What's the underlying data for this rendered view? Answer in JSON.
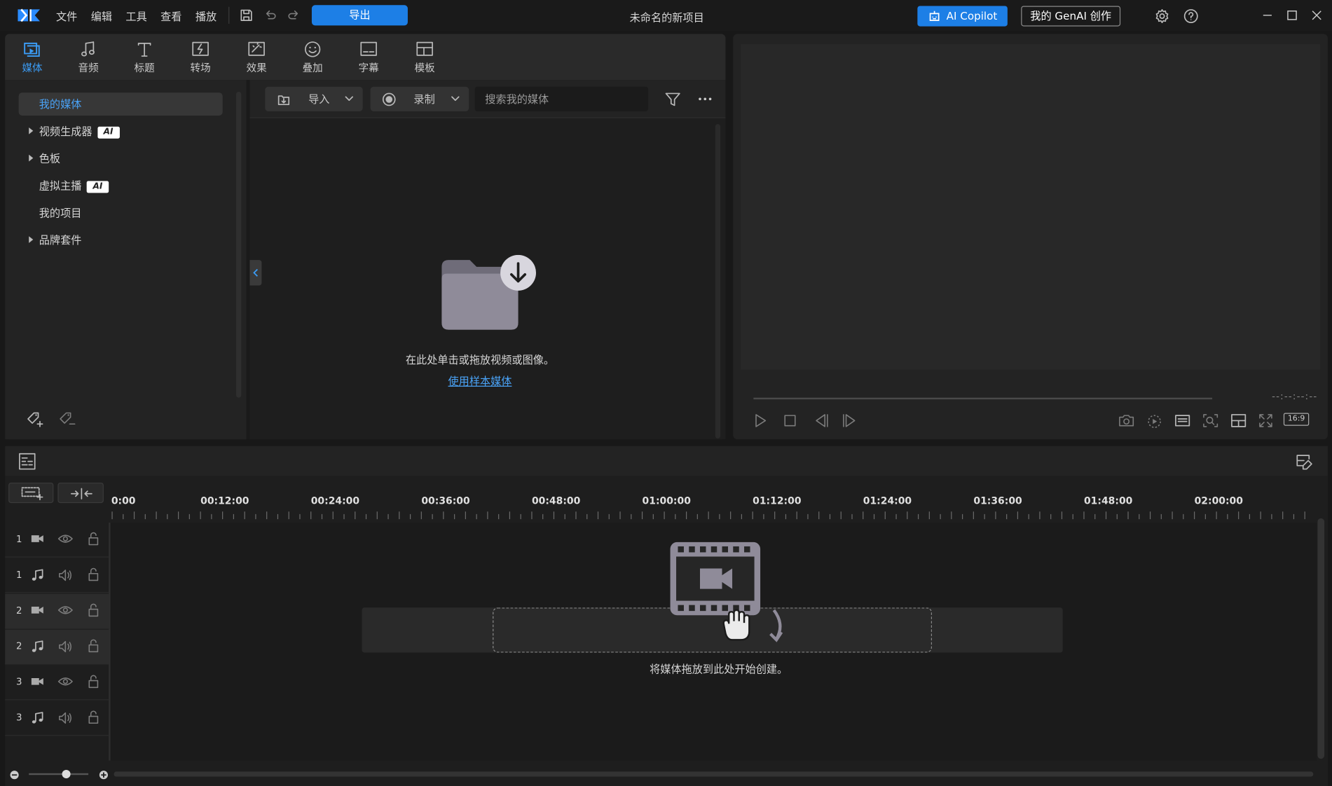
{
  "title_bar": {
    "menus": [
      "文件",
      "编辑",
      "工具",
      "查看",
      "播放"
    ],
    "export_label": "导出",
    "project_title": "未命名的新项目",
    "copilot_label": "AI Copilot",
    "genai_label": "我的 GenAI 创作"
  },
  "tabs": [
    {
      "label": "媒体",
      "icon": "media-icon",
      "active": true
    },
    {
      "label": "音频",
      "icon": "music-note-icon"
    },
    {
      "label": "标题",
      "icon": "title-t-icon"
    },
    {
      "label": "转场",
      "icon": "transition-icon"
    },
    {
      "label": "效果",
      "icon": "effects-icon"
    },
    {
      "label": "叠加",
      "icon": "sticker-icon"
    },
    {
      "label": "字幕",
      "icon": "subtitle-icon"
    },
    {
      "label": "模板",
      "icon": "template-icon"
    }
  ],
  "tree": [
    {
      "label": "我的媒体",
      "active": true
    },
    {
      "label": "视频生成器",
      "expandable": true,
      "badge": "AI"
    },
    {
      "label": "色板",
      "expandable": true
    },
    {
      "label": "虚拟主播",
      "badge": "AI"
    },
    {
      "label": "我的项目"
    },
    {
      "label": "品牌套件",
      "expandable": true
    }
  ],
  "toolbar": {
    "import_label": "导入",
    "record_label": "录制",
    "search_placeholder": "搜索我的媒体"
  },
  "media_area": {
    "empty_message": "在此处单击或拖放视频或图像。",
    "sample_link": "使用样本媒体"
  },
  "preview": {
    "timecode": "--:--:--:--",
    "aspect_ratio": "16:9"
  },
  "timeline": {
    "ruler_labels": [
      "0:00",
      "00:12:00",
      "00:24:00",
      "00:36:00",
      "00:48:00",
      "01:00:00",
      "01:12:00",
      "01:24:00",
      "01:36:00",
      "01:48:00",
      "02:00:00"
    ],
    "tracks": [
      {
        "num": "1",
        "type": "video"
      },
      {
        "num": "1",
        "type": "audio"
      },
      {
        "num": "2",
        "type": "video"
      },
      {
        "num": "2",
        "type": "audio"
      },
      {
        "num": "3",
        "type": "video"
      },
      {
        "num": "3",
        "type": "audio"
      }
    ],
    "drop_message": "将媒体拖放到此处开始创建。"
  },
  "colors": {
    "accent": "#1d7fe6",
    "link": "#4aa3f7",
    "background": "#181818"
  }
}
